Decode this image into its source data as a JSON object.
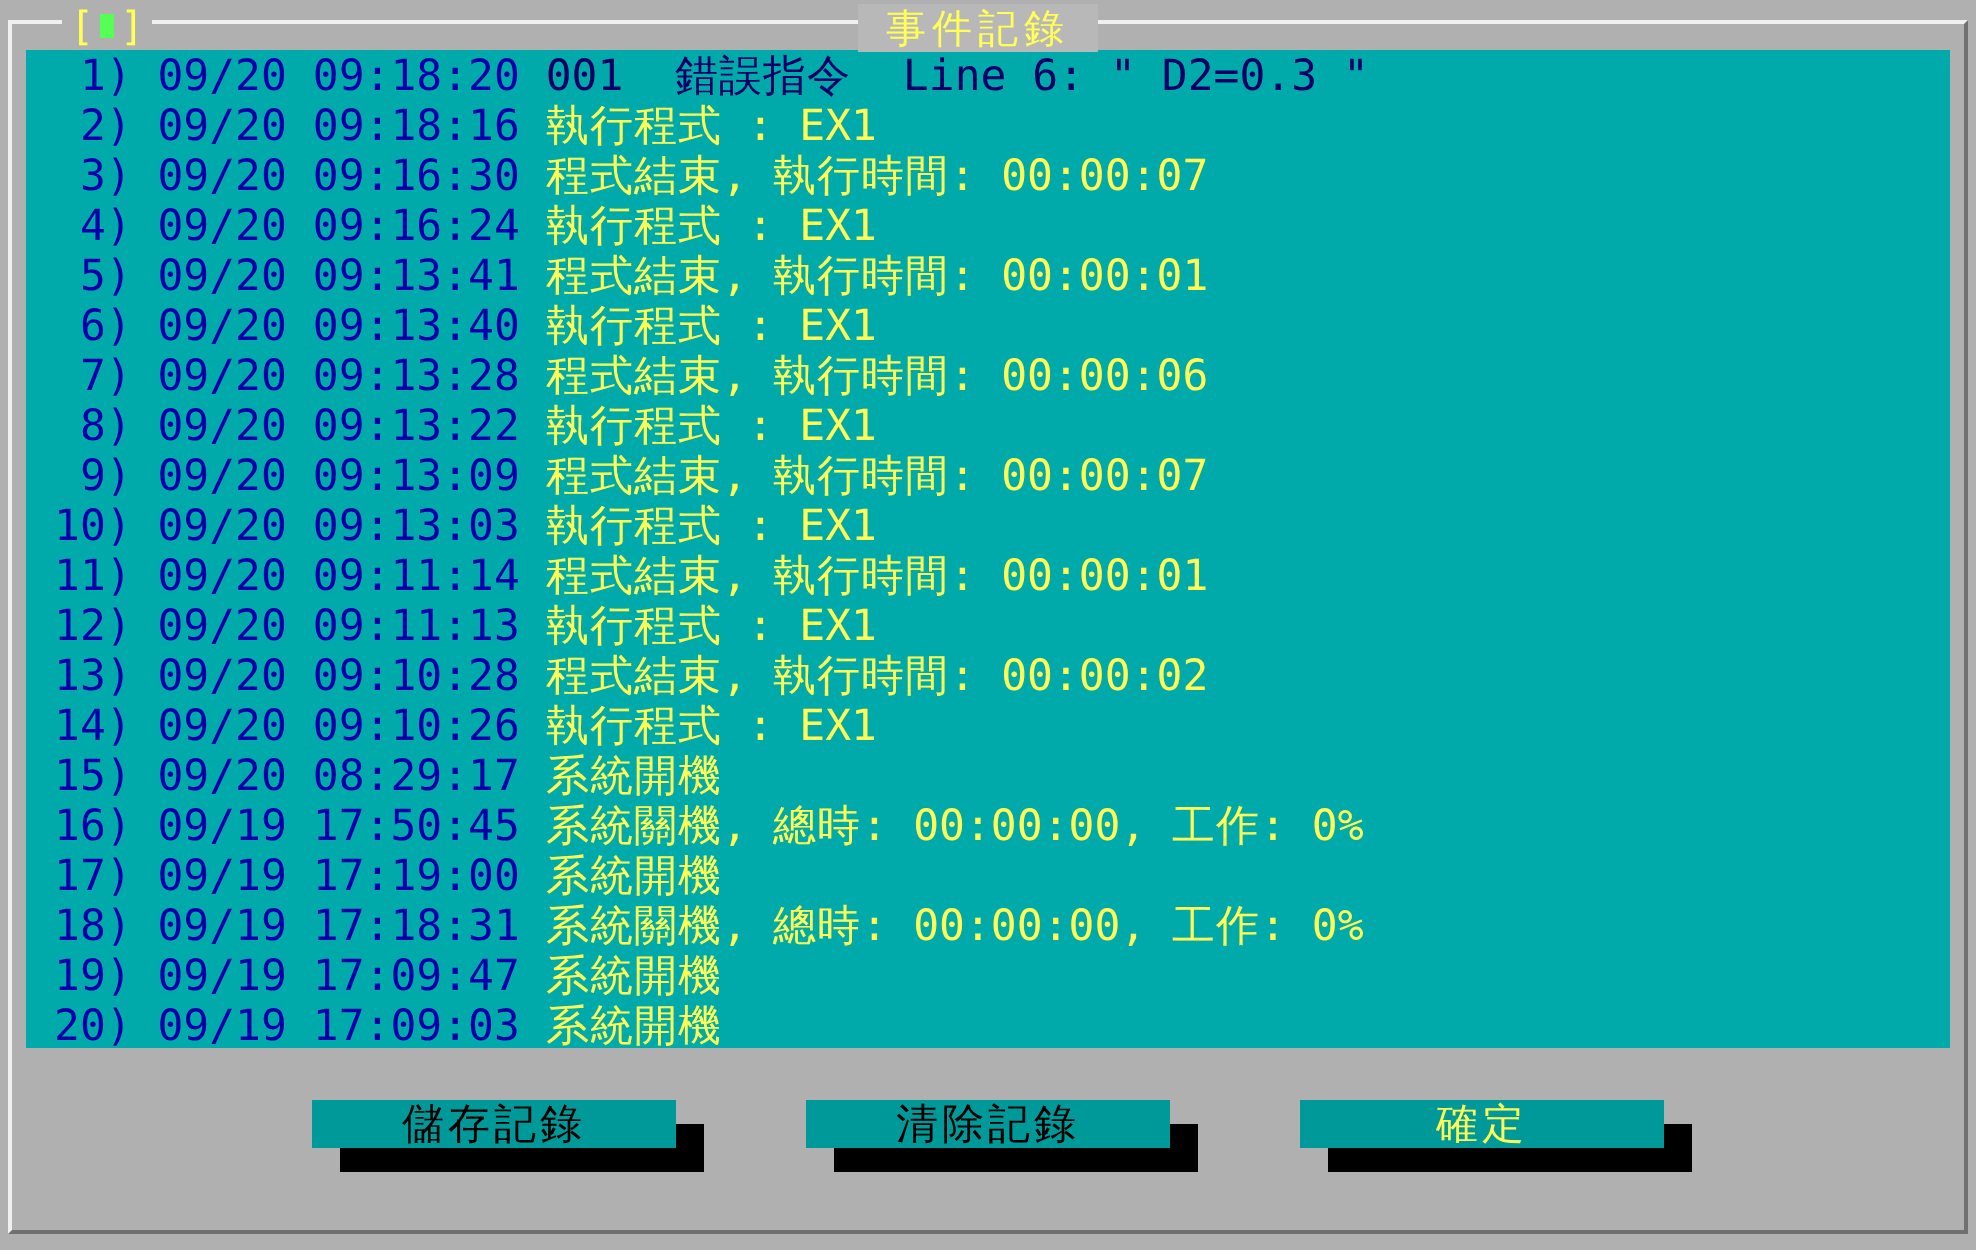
{
  "window": {
    "title": "事件記錄",
    "control_box": {
      "open": "[",
      "close": "]"
    }
  },
  "events": [
    {
      "index": "1)",
      "time": "09/20 09:18:20",
      "message": "001  錯誤指令  Line 6: \" D2=0.3 \"",
      "kind": "error"
    },
    {
      "index": "2)",
      "time": "09/20 09:18:16",
      "message": "執行程式 : EX1",
      "kind": "info"
    },
    {
      "index": "3)",
      "time": "09/20 09:16:30",
      "message": "程式結束, 執行時間: 00:00:07",
      "kind": "info"
    },
    {
      "index": "4)",
      "time": "09/20 09:16:24",
      "message": "執行程式 : EX1",
      "kind": "info"
    },
    {
      "index": "5)",
      "time": "09/20 09:13:41",
      "message": "程式結束, 執行時間: 00:00:01",
      "kind": "info"
    },
    {
      "index": "6)",
      "time": "09/20 09:13:40",
      "message": "執行程式 : EX1",
      "kind": "info"
    },
    {
      "index": "7)",
      "time": "09/20 09:13:28",
      "message": "程式結束, 執行時間: 00:00:06",
      "kind": "info"
    },
    {
      "index": "8)",
      "time": "09/20 09:13:22",
      "message": "執行程式 : EX1",
      "kind": "info"
    },
    {
      "index": "9)",
      "time": "09/20 09:13:09",
      "message": "程式結束, 執行時間: 00:00:07",
      "kind": "info"
    },
    {
      "index": "10)",
      "time": "09/20 09:13:03",
      "message": "執行程式 : EX1",
      "kind": "info"
    },
    {
      "index": "11)",
      "time": "09/20 09:11:14",
      "message": "程式結束, 執行時間: 00:00:01",
      "kind": "info"
    },
    {
      "index": "12)",
      "time": "09/20 09:11:13",
      "message": "執行程式 : EX1",
      "kind": "info"
    },
    {
      "index": "13)",
      "time": "09/20 09:10:28",
      "message": "程式結束, 執行時間: 00:00:02",
      "kind": "info"
    },
    {
      "index": "14)",
      "time": "09/20 09:10:26",
      "message": "執行程式 : EX1",
      "kind": "info"
    },
    {
      "index": "15)",
      "time": "09/20 08:29:17",
      "message": "系統開機",
      "kind": "info"
    },
    {
      "index": "16)",
      "time": "09/19 17:50:45",
      "message": "系統關機, 總時: 00:00:00, 工作: 0%",
      "kind": "info"
    },
    {
      "index": "17)",
      "time": "09/19 17:19:00",
      "message": "系統開機",
      "kind": "info"
    },
    {
      "index": "18)",
      "time": "09/19 17:18:31",
      "message": "系統關機, 總時: 00:00:00, 工作: 0%",
      "kind": "info"
    },
    {
      "index": "19)",
      "time": "09/19 17:09:47",
      "message": "系統開機",
      "kind": "info"
    },
    {
      "index": "20)",
      "time": "09/19 17:09:03",
      "message": "系統開機",
      "kind": "info"
    }
  ],
  "buttons": [
    {
      "label": "儲存記錄",
      "selected": false
    },
    {
      "label": "清除記錄",
      "selected": false
    },
    {
      "label": "確定",
      "selected": true
    }
  ]
}
